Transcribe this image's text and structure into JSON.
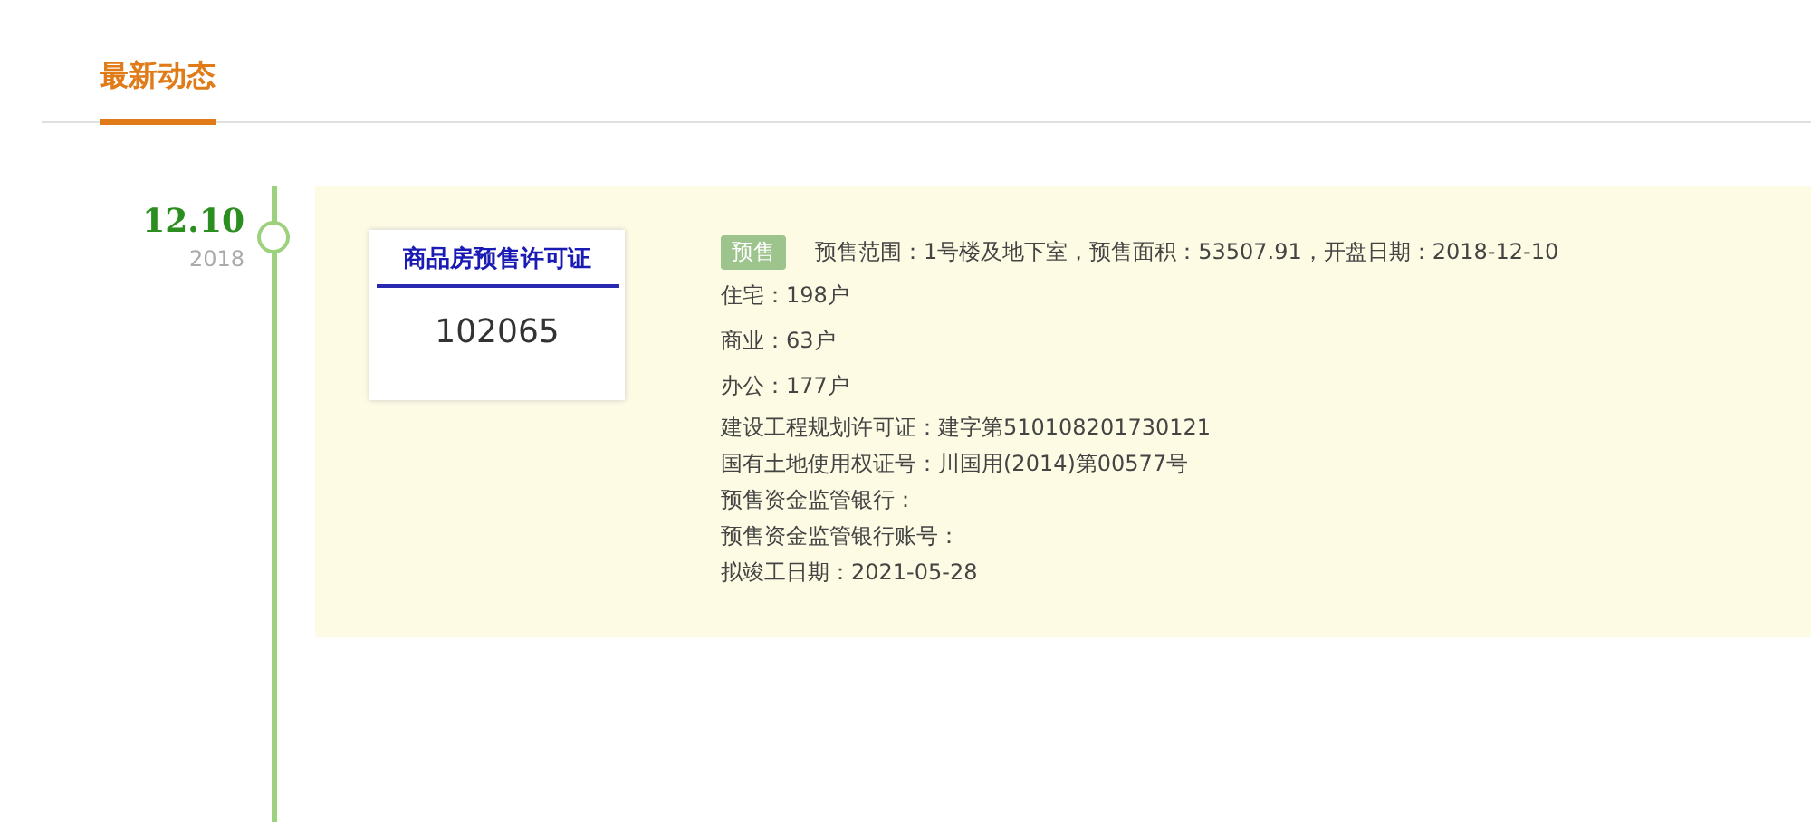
{
  "tabs": [
    {
      "label": "最新动态",
      "selected": true
    }
  ],
  "timeline": [
    {
      "date": "12.10",
      "year": "2018",
      "certificate": {
        "title": "商品房预售许可证",
        "number": "102065"
      },
      "tag": "预售",
      "headline": "预售范围：1号楼及地下室，预售面积：53507.91，开盘日期：2018-12-10",
      "lines": [
        {
          "kind": "count",
          "text": "住宅：198户"
        },
        {
          "kind": "count",
          "text": "商业：63户"
        },
        {
          "kind": "count",
          "text": "办公：177户"
        },
        {
          "kind": "detail",
          "text": "建设工程规划许可证：建字第510108201730121"
        },
        {
          "kind": "detail",
          "text": "国有土地使用权证号：川国用(2014)第00577号"
        },
        {
          "kind": "detail",
          "text": "预售资金监管银行："
        },
        {
          "kind": "detail",
          "text": "预售资金监管银行账号："
        },
        {
          "kind": "detail",
          "text": "拟竣工日期：2021-05-28"
        }
      ]
    }
  ]
}
